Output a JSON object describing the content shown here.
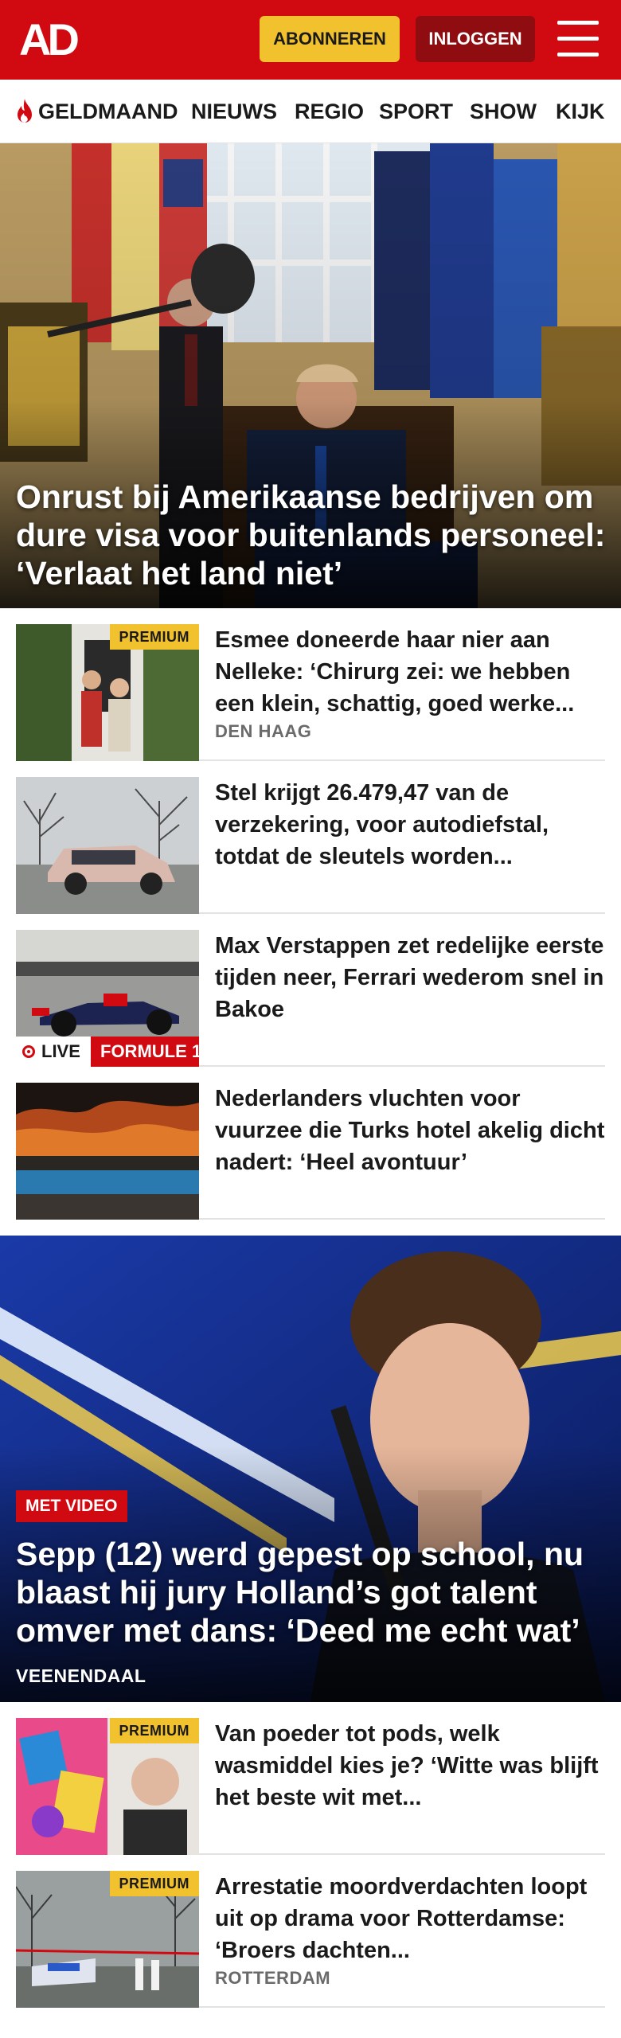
{
  "header": {
    "logo": "AD",
    "subscribe_label": "ABONNEREN",
    "login_label": "INLOGGEN",
    "brand_color": "#d10a11",
    "accent_color": "#f2c12e"
  },
  "nav": {
    "items": [
      "GELDMAAND",
      "NIEUWS",
      "REGIO",
      "SPORT",
      "SHOW",
      "KIJK"
    ]
  },
  "hero": {
    "title": "Onrust bij Amerikaanse bedrijven om dure visa voor buitenlands personeel: ‘Verlaat het land niet’"
  },
  "articles": [
    {
      "title": "Esmee doneerde haar nier aan Nelleke: ‘Chirurg zei: we hebben een klein, schattig, goed werke...",
      "location": "DEN HAAG",
      "badge": "PREMIUM"
    },
    {
      "title": "Stel krijgt 26.479,47 van de verzekering, voor autodiefstal, totdat de sleutels worden..."
    },
    {
      "title": "Max Verstappen zet redelijke eerste tijden neer, Ferrari wederom snel in Bakoe",
      "live_label": "LIVE",
      "tag": "FORMULE 1"
    },
    {
      "title": "Nederlanders vluchten voor vuurzee die Turks hotel akelig dicht nadert: ‘Heel avontuur’"
    }
  ],
  "feature": {
    "badge": "MET VIDEO",
    "title": "Sepp (12) werd gepest op school, nu blaast hij jury Holland’s got talent omver met dans: ‘Deed me echt wat’",
    "location": "VEENENDAAL"
  },
  "articles2": [
    {
      "title": "Van poeder tot pods, welk wasmiddel kies je? ‘Witte was blijft het beste wit met...",
      "badge": "PREMIUM"
    },
    {
      "title": "Arrestatie moordverdachten loopt uit op drama voor Rotterdamse: ‘Broers dachten...",
      "location": "ROTTERDAM",
      "badge": "PREMIUM"
    }
  ]
}
